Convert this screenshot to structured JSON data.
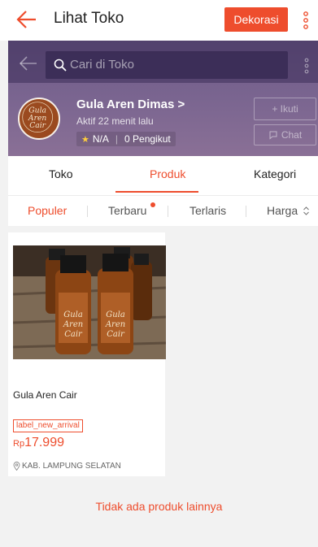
{
  "appbar": {
    "title": "Lihat Toko",
    "dekorasi_label": "Dekorasi"
  },
  "shop": {
    "search_placeholder": "Cari di Toko",
    "name": "Gula Aren Dimas",
    "name_chevron": ">",
    "active_status": "Aktif 22 menit lalu",
    "rating": "N/A",
    "followers": "0 Pengikut",
    "follow_label": "+ Ikuti",
    "chat_label": "Chat",
    "logo_text_line1": "Gula",
    "logo_text_line2": "Aren",
    "logo_text_line3": "Cair"
  },
  "tabs": [
    {
      "label": "Toko"
    },
    {
      "label": "Produk"
    },
    {
      "label": "Kategori"
    }
  ],
  "sort": [
    {
      "label": "Populer"
    },
    {
      "label": "Terbaru"
    },
    {
      "label": "Terlaris"
    },
    {
      "label": "Harga"
    }
  ],
  "product": {
    "name": "Gula Aren Cair",
    "badge": "label_new_arrival",
    "price_currency": "Rp",
    "price_value": "17.999",
    "location": "KAB. LAMPUNG SELATAN"
  },
  "footer_message": "Tidak ada produk lainnya",
  "colors": {
    "accent": "#ee4d2d",
    "shop_header": "#7a6590"
  },
  "icons": [
    "arrow-left-icon",
    "more-vertical-icon",
    "search-icon",
    "star-icon",
    "chat-bubble-icon",
    "sort-updown-icon",
    "location-pin-icon"
  ]
}
